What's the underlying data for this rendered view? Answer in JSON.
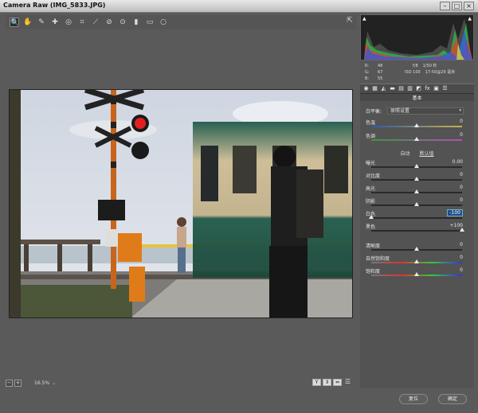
{
  "window": {
    "title": "Camera Raw (IMG_5833.JPG)",
    "minimize": "–",
    "maximize": "□",
    "close": "×"
  },
  "toolbar": {
    "tools": [
      {
        "name": "zoom-tool",
        "glyph": "🔍"
      },
      {
        "name": "hand-tool",
        "glyph": "✋"
      },
      {
        "name": "white-balance-tool",
        "glyph": "✎"
      },
      {
        "name": "color-sampler-tool",
        "glyph": "✚"
      },
      {
        "name": "targeted-adjustment-tool",
        "glyph": "◎"
      },
      {
        "name": "crop-tool",
        "glyph": "⌗"
      },
      {
        "name": "straighten-tool",
        "glyph": "⟋"
      },
      {
        "name": "spot-removal-tool",
        "glyph": "⊘"
      },
      {
        "name": "red-eye-tool",
        "glyph": "⊙"
      },
      {
        "name": "adjustment-brush-tool",
        "glyph": "▮"
      },
      {
        "name": "graduated-filter-tool",
        "glyph": "▭"
      },
      {
        "name": "radial-filter-tool",
        "glyph": "○"
      }
    ],
    "open_preferences_glyph": "⇱"
  },
  "status": {
    "zoom_out": "−",
    "zoom_in": "+",
    "zoom_level": "16.5%",
    "zoom_dropdown": "⌄",
    "view_buttons": [
      "Y",
      "⇕",
      "⇔",
      "☰"
    ]
  },
  "histogram": {
    "shadow_clip_icon": "▲",
    "highlight_clip_icon": "▲"
  },
  "readout": {
    "r_label": "R:",
    "r_value": "48",
    "g_label": "G:",
    "g_value": "67",
    "b_label": "B:",
    "b_value": "55",
    "aperture": "f/8",
    "shutter": "1/50 秒",
    "iso": "ISO 100",
    "lens": "17-50@29 毫米"
  },
  "tabs": [
    "◉",
    "▦",
    "◭",
    "▬",
    "▤",
    "▥",
    "◩",
    "fx",
    "▣",
    "☰"
  ],
  "basic": {
    "title": "基本",
    "white_balance_label": "白平衡:",
    "white_balance_value": "原照设置",
    "temperature_label": "色温",
    "temperature_value": "0",
    "tint_label": "色调",
    "tint_value": "0",
    "auto_label": "自动",
    "default_label": "默认值",
    "exposure_label": "曝光",
    "exposure_value": "0.00",
    "contrast_label": "对比度",
    "contrast_value": "0",
    "highlights_label": "高光",
    "highlights_value": "0",
    "shadows_label": "阴影",
    "shadows_value": "0",
    "whites_label": "白色",
    "whites_value": "-100",
    "blacks_label": "黑色",
    "blacks_value": "+100",
    "clarity_label": "清晰度",
    "clarity_value": "0",
    "vibrance_label": "自然饱和度",
    "vibrance_value": "0",
    "saturation_label": "饱和度",
    "saturation_value": "0"
  },
  "buttons": {
    "reset": "复位",
    "ok": "确定"
  },
  "colors": {
    "panel_bg": "#535353",
    "highlight_field": "#1d4f8c"
  }
}
